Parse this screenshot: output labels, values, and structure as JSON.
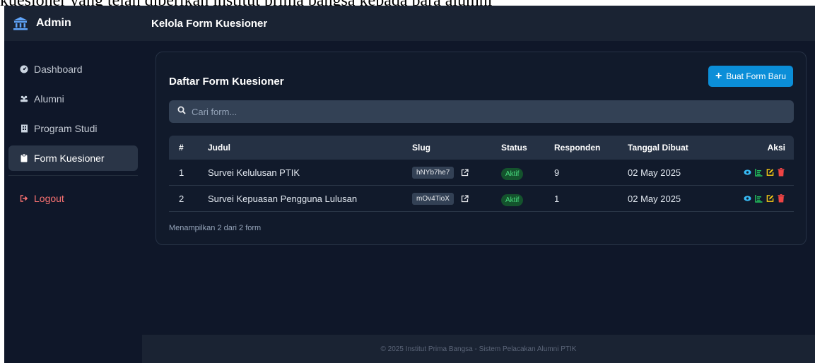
{
  "caption": "kuesioner yang telah diberikan institut prima bangsa kepada para alumni",
  "brand": {
    "title": "Admin"
  },
  "sidebar": {
    "items": [
      {
        "label": "Dashboard",
        "icon": "dashboard-icon"
      },
      {
        "label": "Alumni",
        "icon": "users-icon"
      },
      {
        "label": "Program Studi",
        "icon": "building-icon"
      },
      {
        "label": "Form Kuesioner",
        "icon": "clipboard-icon",
        "active": true
      }
    ],
    "logout": "Logout"
  },
  "topbar": {
    "title": "Kelola Form Kuesioner"
  },
  "card": {
    "title": "Daftar Form Kuesioner",
    "new_button": "Buat Form Baru",
    "search_placeholder": "Cari form...",
    "columns": [
      "#",
      "Judul",
      "Slug",
      "Status",
      "Responden",
      "Tanggal Dibuat",
      "Aksi"
    ],
    "rows": [
      {
        "num": "1",
        "judul": "Survei Kelulusan PTIK",
        "slug": "hNYb7he7",
        "status": "Aktif",
        "responden": "9",
        "tanggal": "02 May 2025"
      },
      {
        "num": "2",
        "judul": "Survei Kepuasan Pengguna Lulusan",
        "slug": "mOv4TioX",
        "status": "Aktif",
        "responden": "1",
        "tanggal": "02 May 2025"
      }
    ],
    "summary": "Menampilkan 2 dari 2 form"
  },
  "footer": {
    "text": "© 2025 Institut Prima Bangsa - Sistem Pelacakan Alumni PTIK"
  },
  "colors": {
    "accent": "#0b8ed8",
    "status_active": "#4ade80",
    "view": "#38bdf8",
    "chart": "#22c55e",
    "edit": "#facc15",
    "delete": "#ef4444"
  }
}
